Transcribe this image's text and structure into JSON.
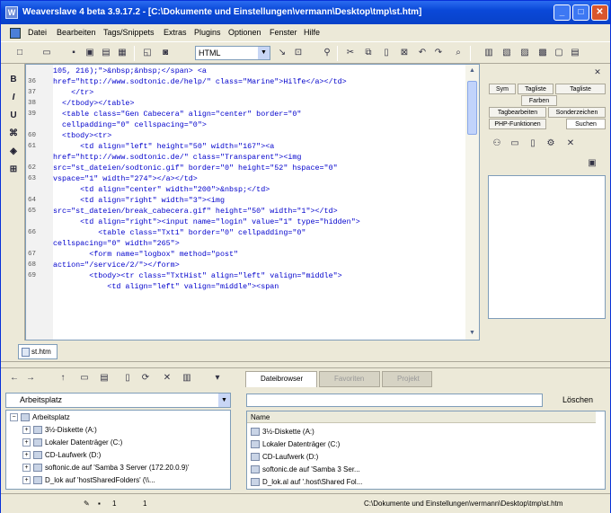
{
  "window": {
    "title": "Weaverslave 4 beta 3.9.17.2 - [C:\\Dokumente und Einstellungen\\vermann\\Desktop\\tmp\\st.htm]"
  },
  "menu": [
    "Datei",
    "Bearbeiten",
    "Tags/Snippets",
    "Extras",
    "Plugins",
    "Optionen",
    "Fenster",
    "Hilfe"
  ],
  "toolbar": {
    "language": "HTML"
  },
  "editor": {
    "line_numbers": [
      "",
      "36",
      "37",
      "38",
      "39",
      "",
      "60",
      "61",
      "",
      "62",
      "63",
      "",
      "64",
      "65",
      "",
      "66",
      "",
      "67",
      "68",
      "69"
    ],
    "lines": [
      "105, 216);\">&nbsp;&nbsp;</span> <a",
      "href=\"http://www.sodtonic.de/help/\" class=\"Marine\">Hilfe</a></td>",
      "    </tr>",
      "  </tbody></table>",
      "  <table class=\"Gen Cabecera\" align=\"center\" border=\"0\"",
      "  cellpadding=\"0\" cellspacing=\"0\">",
      "  <tbody><tr>",
      "      <td align=\"left\" height=\"50\" width=\"167\"><a",
      "href=\"http://www.sodtonic.de/\" class=\"Transparent\"><img",
      "src=\"st_dateien/sodtonic.gif\" border=\"0\" height=\"52\" hspace=\"0\"",
      "vspace=\"1\" width=\"274\"></a></td>",
      "      <td align=\"center\" width=\"200\">&nbsp;</td>",
      "      <td align=\"right\" width=\"3\"><img",
      "src=\"st_dateien/break_cabecera.gif\" height=\"50\" width=\"1\"></td>",
      "      <td align=\"right\"><input name=\"login\" value=\"1\" type=\"hidden\">",
      "          <table class=\"Txt1\" border=\"0\" cellpadding=\"0\"",
      "cellspacing=\"0\" width=\"265\">",
      "        <form name=\"logbox\" method=\"post\"",
      "action=\"/service/2/\"></form>",
      "        <tbody><tr class=\"TxtHist\" align=\"left\" valign=\"middle\">",
      "            <td align=\"left\" valign=\"middle\"><span"
    ]
  },
  "right_panel": {
    "tabs_row1": [
      "Sym",
      "Tagliste",
      "Tagliste",
      "Farben"
    ],
    "tabs_row2": [
      "Tagbearbeiten",
      "Sonderzeichen"
    ],
    "tabs_row3": [
      "PHP-Funktionen",
      "Suchen"
    ]
  },
  "file_tab": {
    "label": "st.htm"
  },
  "workspace": {
    "label": "Arbeitsplatz",
    "tree": [
      "Arbeitsplatz",
      "3½-Diskette (A:)",
      "Lokaler Datenträger (C:)",
      "CD-Laufwerk (D:)",
      "softonic.de auf 'Samba 3 Server (172.20.0.9)'",
      "D_lok auf 'hostSharedFolders' (\\\\..."
    ]
  },
  "file_browser": {
    "tabs": [
      "Dateibrowser",
      "Favoriten",
      "Projekt"
    ],
    "clear_button": "Löschen",
    "column": "Name",
    "items": [
      "3½-Diskette (A:)",
      "Lokaler Datenträger (C:)",
      "CD-Laufwerk (D:)",
      "softonic.de auf 'Samba 3 Ser...",
      "D_lok.al auf '.host\\Shared Fol..."
    ]
  },
  "status": {
    "line": "1",
    "col": "1",
    "path": "C:\\Dokumente und Einstellungen\\vermann\\Desktop\\tmp\\st.htm"
  }
}
